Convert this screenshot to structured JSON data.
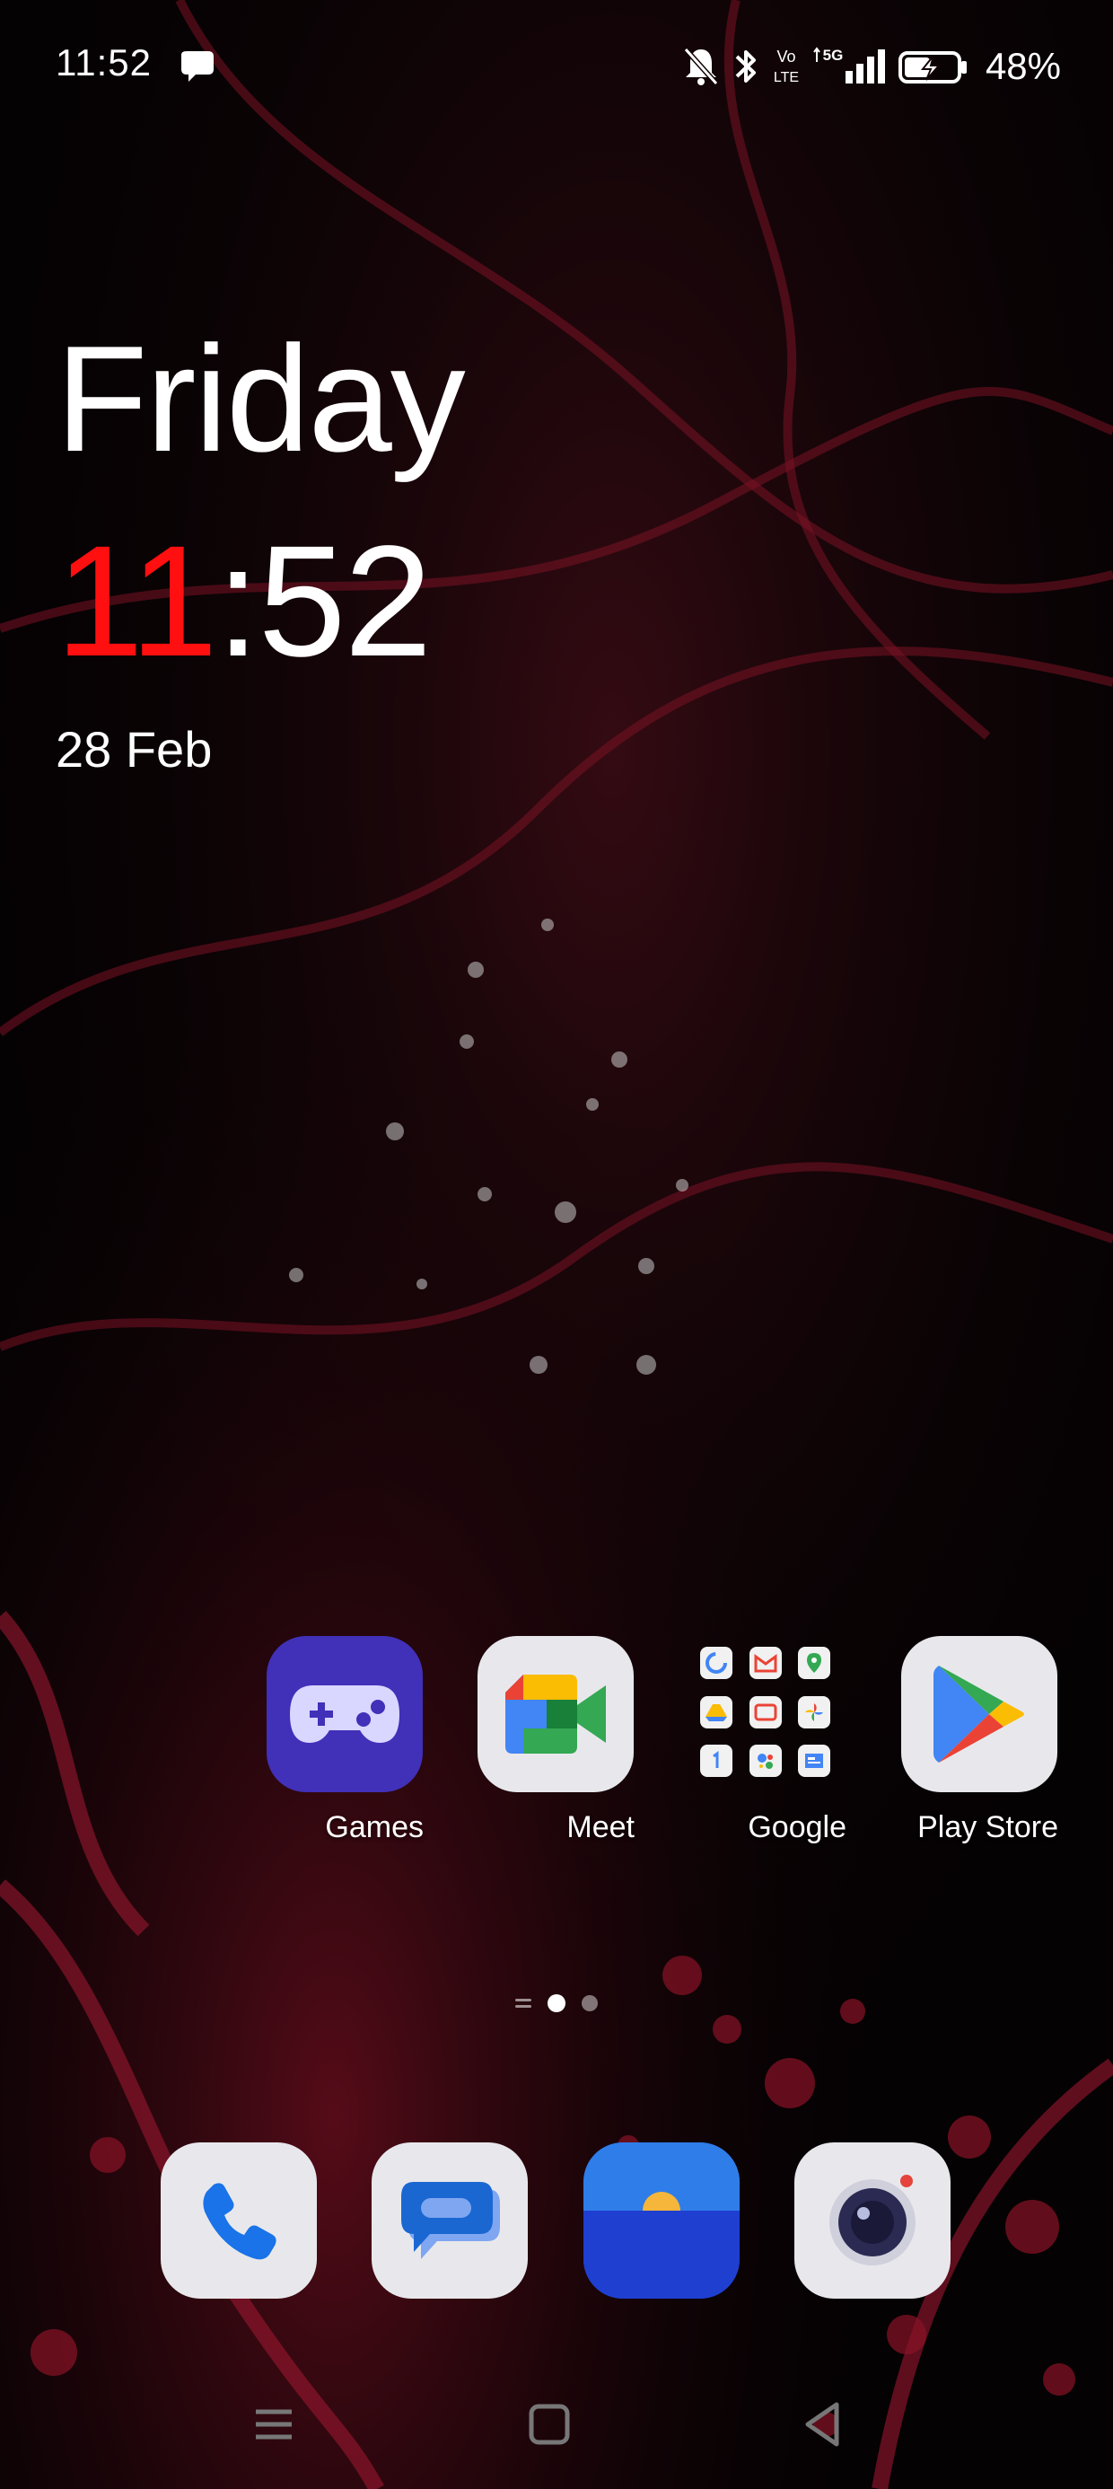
{
  "status_bar": {
    "time": "11:52",
    "battery_percent": "48%",
    "icons": [
      "chat-bubble-icon",
      "notifications-off-icon",
      "bluetooth-icon",
      "volte-icon",
      "5g-signal-icon",
      "battery-charging-icon"
    ],
    "network_label": "5G",
    "volte_label_top": "Vo",
    "volte_label_bottom": "LTE"
  },
  "clock_widget": {
    "weekday": "Friday",
    "hour": "11",
    "separator": ":",
    "minute": "52",
    "date": "28 Feb",
    "hour_color": "#ff0f0f"
  },
  "apps": [
    {
      "label": "Games",
      "icon": "gamepad-icon"
    },
    {
      "label": "Meet",
      "icon": "google-meet-icon"
    },
    {
      "label": "Google",
      "icon": "folder-icon"
    },
    {
      "label": "Play Store",
      "icon": "play-store-icon"
    }
  ],
  "dock": [
    {
      "icon": "phone-icon"
    },
    {
      "icon": "messages-icon"
    },
    {
      "icon": "gallery-icon"
    },
    {
      "icon": "camera-icon"
    }
  ],
  "page_indicator": {
    "pages": 2,
    "current": 1
  },
  "nav_bar": {
    "buttons": [
      "recents-icon",
      "home-icon",
      "back-icon"
    ]
  },
  "colors": {
    "wallpaper_base": "#050203",
    "wallpaper_accent": "#8a1326",
    "games_tile": "#4130b8"
  }
}
